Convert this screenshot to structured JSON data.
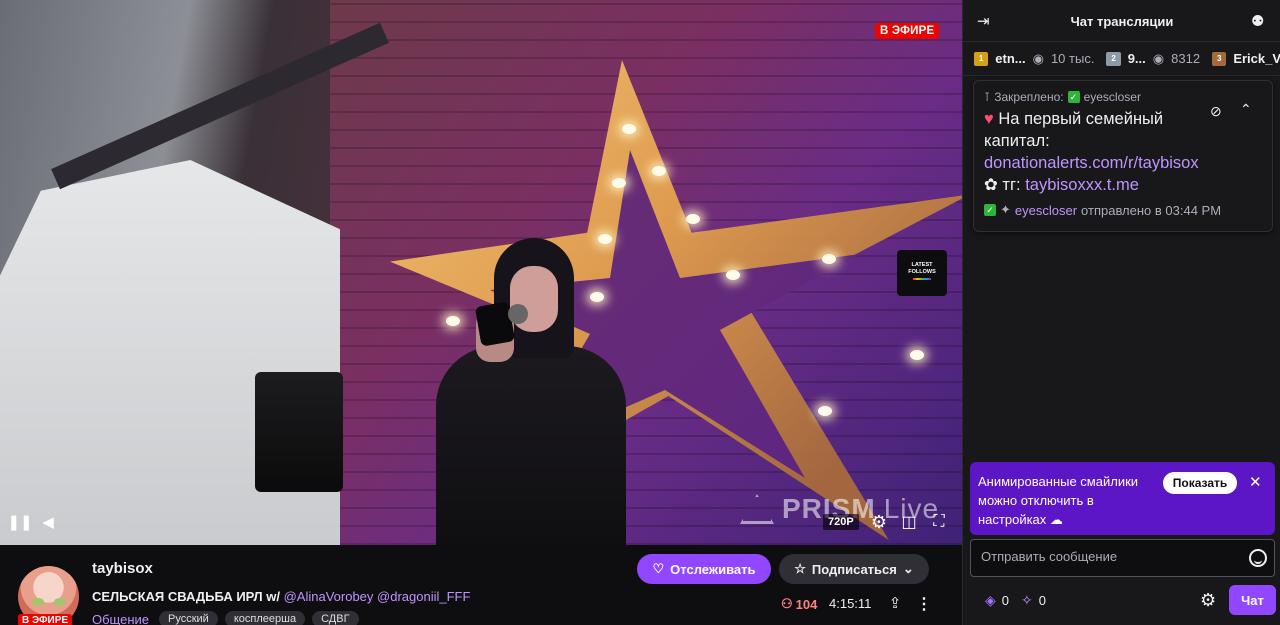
{
  "video": {
    "live_badge": "В ЭФИРЕ",
    "overlay": {
      "latest_follows_line1": "LATEST",
      "latest_follows_line2": "FOLLOWS",
      "watermark_brand": "PRISM",
      "watermark_suffix": "Live"
    },
    "controls": {
      "quality": "720P",
      "pause_icon": "pause-icon",
      "volume_icon": "volume-icon",
      "settings_icon": "gear-icon",
      "theatre_icon": "theatre-mode-icon",
      "fullscreen_icon": "fullscreen-icon"
    }
  },
  "channel": {
    "streamer_name": "taybisox",
    "avatar_live_badge": "В ЭФИРЕ",
    "title_text": "СЕЛЬСКАЯ СВАДЬБА ИРЛ w/ ",
    "title_mention1": "@AlinaVorobey",
    "title_mention2": "@dragoniil_FFF",
    "category": "Общение",
    "tags": [
      "Русский",
      "косплеерша",
      "СДВГ"
    ],
    "follow_label": "Отслеживать",
    "subscribe_label": "Подписаться",
    "viewers": "104",
    "uptime": "4:15:11"
  },
  "chat": {
    "header_title": "Чат трансляции",
    "leaderboard": [
      {
        "rank": "1",
        "name": "etn...",
        "value": "10 тыс."
      },
      {
        "rank": "2",
        "name": "9...",
        "value": "8312"
      },
      {
        "rank": "3",
        "name": "Erick_V",
        "value": ""
      }
    ],
    "pinned": {
      "label": "Закреплено:",
      "pinned_by": "eyescloser",
      "message_text": "На первый семейный капитал:",
      "link1": "donationalerts.com/r/taybisox",
      "link_sep": "тг:",
      "link2": "taybisoxxx.t.me",
      "sender": "eyescloser",
      "sent_text": "отправлено в 03:44 PM"
    },
    "notice": {
      "text": "Анимированные смайлики можно отключить в настройках",
      "show_label": "Показать"
    },
    "input_placeholder": "Отправить сообщение",
    "points_value": "0",
    "bits_value": "0",
    "send_label": "Чат"
  },
  "colors": {
    "brand": "#9147ff",
    "live": "#eb0400",
    "link": "#bf94ff",
    "chat_bg": "#18181b",
    "page_bg": "#0e0e10",
    "notice_bg": "#5c16c5",
    "viewers": "#ff8280"
  }
}
